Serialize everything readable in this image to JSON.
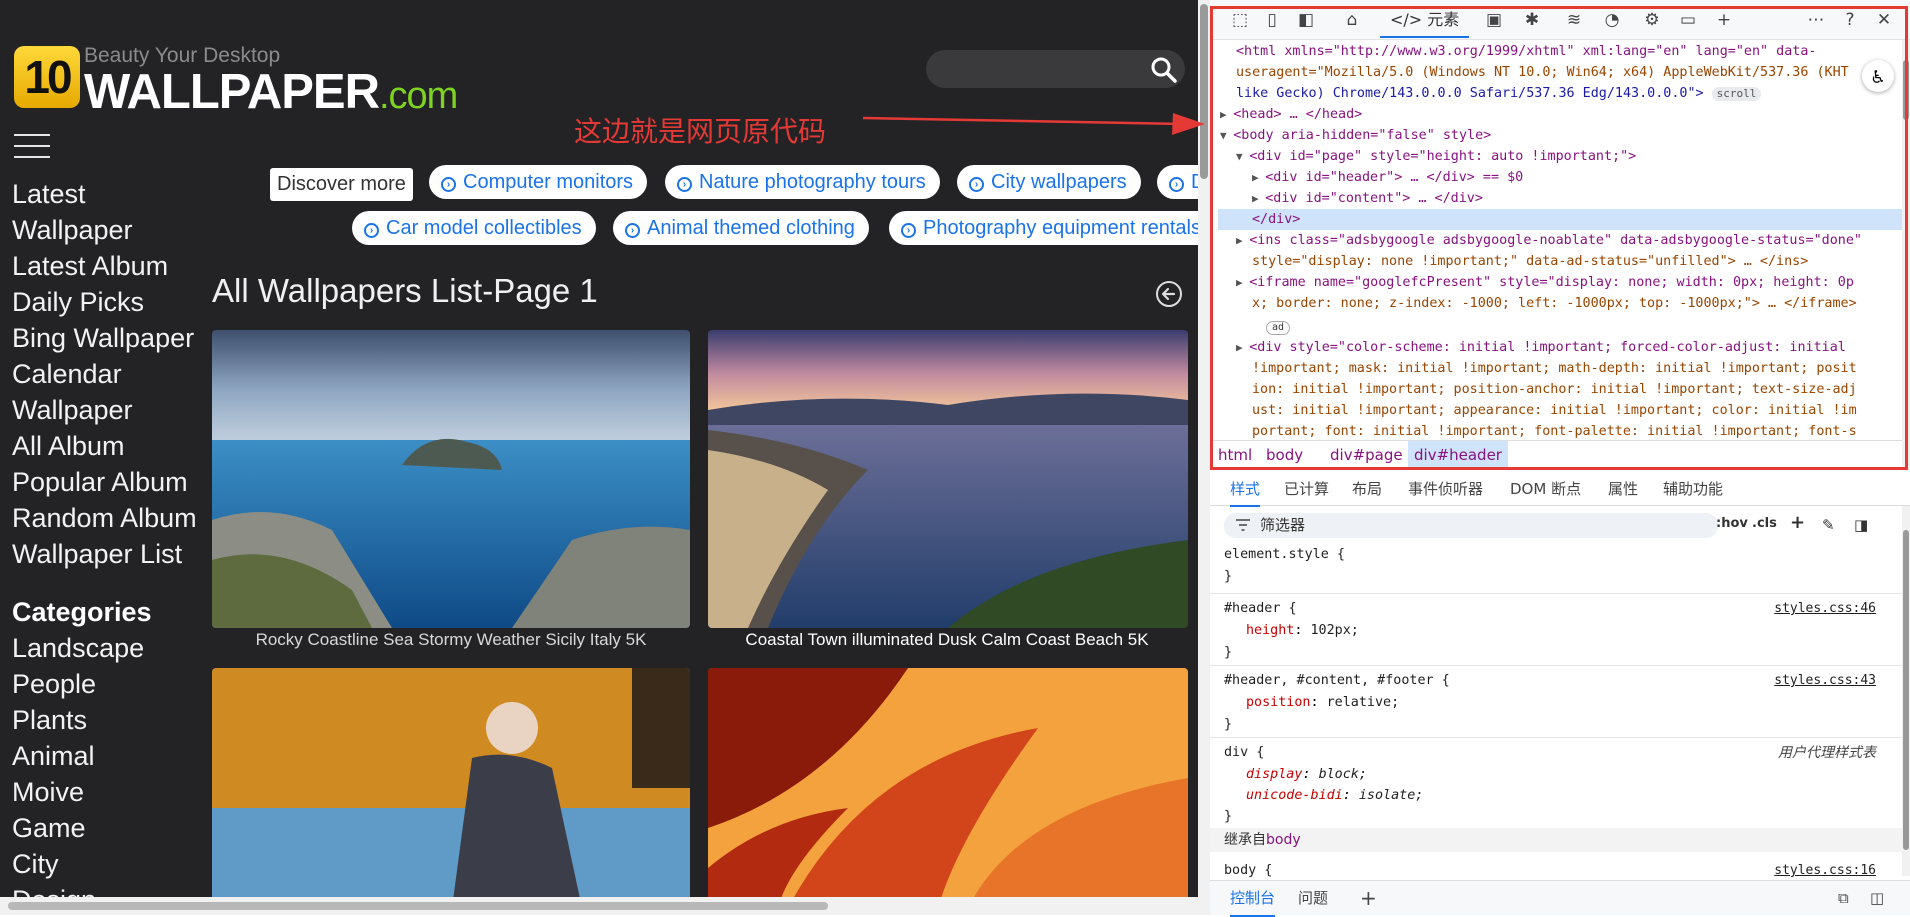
{
  "site": {
    "logo_number": "10",
    "logo_tagline": "Beauty Your Desktop",
    "logo_brand": "WALLPAPER",
    "logo_domain": ".com",
    "nav": [
      "Latest Wallpaper",
      "Latest Album",
      "Daily Picks",
      "Bing Wallpaper",
      "Calendar Wallpaper",
      "All Album",
      "Popular Album",
      "Random Album",
      "Wallpaper List"
    ],
    "nav_lines": [
      "Latest",
      "Wallpaper",
      "Latest Album",
      "Daily Picks",
      "Bing Wallpaper",
      "Calendar",
      "Wallpaper",
      "All Album",
      "Popular Album",
      "Random Album",
      "Wallpaper List"
    ],
    "categories_heading": "Categories",
    "categories": [
      "Landscape",
      "People",
      "Plants",
      "Animal",
      "Moive",
      "Game",
      "City",
      "Design"
    ],
    "discover_label": "Discover more",
    "chips_row1": [
      "Computer monitors",
      "Nature photography tours",
      "City wallpapers",
      "D"
    ],
    "chips_row2": [
      "Car model collectibles",
      "Animal themed clothing",
      "Photography equipment rentals"
    ],
    "list_title": "All Wallpapers List-Page 1",
    "captions": [
      "Rocky Coastline Sea Stormy Weather Sicily Italy 5K",
      "Coastal Town illuminated Dusk Calm Coast Beach 5K"
    ]
  },
  "annotation": "这边就是网页原代码",
  "devtools": {
    "elements_tab": "元素",
    "dom_lines": [
      {
        "t": "<html xmlns=\"http://www.w3.org/1999/xhtml\" xml:lang=\"en\" lang=\"en\" data-"
      },
      {
        "t": "useragent=\"Mozilla/5.0 (Windows NT 10.0; Win64; x64) AppleWebKit/537.36 (KHT"
      },
      {
        "t": "like Gecko) Chrome/143.0.0.0 Safari/537.36 Edg/143.0.0.0\">"
      },
      {
        "t": "<head> … </head>"
      },
      {
        "t": "<body aria-hidden=\"false\" style>"
      },
      {
        "t": "<div id=\"page\" style=\"height: auto !important;\">"
      },
      {
        "t": "<div id=\"header\"> … </div> == $0"
      },
      {
        "t": "<div id=\"content\"> … </div>"
      },
      {
        "t": "</div>"
      },
      {
        "t": "<ins class=\"adsbygoogle adsbygoogle-noablate\" data-adsbygoogle-status=\"done\""
      },
      {
        "t": "style=\"display: none !important;\" data-ad-status=\"unfilled\"> … </ins>"
      },
      {
        "t": "<iframe name=\"googlefcPresent\" style=\"display: none; width: 0px; height: 0p"
      },
      {
        "t": "x; border: none; z-index: -1000; left: -1000px; top: -1000px;\"> … </iframe>"
      },
      {
        "t": ""
      },
      {
        "t": "<div style=\"color-scheme: initial !important; forced-color-adjust: initial"
      },
      {
        "t": "!important; mask: initial !important; math-depth: initial !important; posit"
      },
      {
        "t": "ion: initial !important; position-anchor: initial !important; text-size-adj"
      },
      {
        "t": "ust: initial !important; appearance: initial !important; color: initial !im"
      },
      {
        "t": "portant; font: initial !important; font-palette: initial !important; font-s"
      }
    ],
    "scroll_badge": "scroll",
    "ad_badge": "ad",
    "breadcrumb": [
      "html",
      "body",
      "div#page",
      "div#header"
    ],
    "subtabs": [
      "样式",
      "已计算",
      "布局",
      "事件侦听器",
      "DOM 断点",
      "属性",
      "辅助功能"
    ],
    "filter_placeholder": "筛选器",
    "hov": ":hov",
    "cls": ".cls",
    "rules": [
      {
        "selector": "element.style {",
        "props": [],
        "close": "}"
      },
      {
        "selector": "#header {",
        "source": "styles.css:46",
        "props": [
          [
            "height",
            "102px;"
          ]
        ],
        "close": "}"
      },
      {
        "selector": "#header, #content, #footer {",
        "source": "styles.css:43",
        "props": [
          [
            "position",
            "relative;"
          ]
        ],
        "close": "}"
      },
      {
        "selector": "div {",
        "source": "用户代理样式表",
        "props": [
          [
            "display",
            "block;"
          ],
          [
            "unicode-bidi",
            "isolate;"
          ]
        ],
        "close": "}"
      }
    ],
    "inherited_label": "继承自",
    "inherited_from": "body",
    "body_rule": "body {",
    "body_source": "styles.css:16",
    "drawer_tabs": [
      "控制台",
      "问题"
    ]
  }
}
